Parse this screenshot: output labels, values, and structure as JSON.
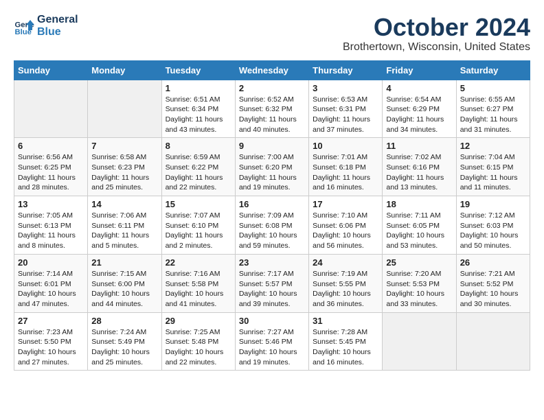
{
  "header": {
    "logo_general": "General",
    "logo_blue": "Blue",
    "month_title": "October 2024",
    "location": "Brothertown, Wisconsin, United States"
  },
  "days_of_week": [
    "Sunday",
    "Monday",
    "Tuesday",
    "Wednesday",
    "Thursday",
    "Friday",
    "Saturday"
  ],
  "weeks": [
    [
      {
        "day": "",
        "empty": true
      },
      {
        "day": "",
        "empty": true
      },
      {
        "day": "1",
        "sunrise": "Sunrise: 6:51 AM",
        "sunset": "Sunset: 6:34 PM",
        "daylight": "Daylight: 11 hours and 43 minutes."
      },
      {
        "day": "2",
        "sunrise": "Sunrise: 6:52 AM",
        "sunset": "Sunset: 6:32 PM",
        "daylight": "Daylight: 11 hours and 40 minutes."
      },
      {
        "day": "3",
        "sunrise": "Sunrise: 6:53 AM",
        "sunset": "Sunset: 6:31 PM",
        "daylight": "Daylight: 11 hours and 37 minutes."
      },
      {
        "day": "4",
        "sunrise": "Sunrise: 6:54 AM",
        "sunset": "Sunset: 6:29 PM",
        "daylight": "Daylight: 11 hours and 34 minutes."
      },
      {
        "day": "5",
        "sunrise": "Sunrise: 6:55 AM",
        "sunset": "Sunset: 6:27 PM",
        "daylight": "Daylight: 11 hours and 31 minutes."
      }
    ],
    [
      {
        "day": "6",
        "sunrise": "Sunrise: 6:56 AM",
        "sunset": "Sunset: 6:25 PM",
        "daylight": "Daylight: 11 hours and 28 minutes."
      },
      {
        "day": "7",
        "sunrise": "Sunrise: 6:58 AM",
        "sunset": "Sunset: 6:23 PM",
        "daylight": "Daylight: 11 hours and 25 minutes."
      },
      {
        "day": "8",
        "sunrise": "Sunrise: 6:59 AM",
        "sunset": "Sunset: 6:22 PM",
        "daylight": "Daylight: 11 hours and 22 minutes."
      },
      {
        "day": "9",
        "sunrise": "Sunrise: 7:00 AM",
        "sunset": "Sunset: 6:20 PM",
        "daylight": "Daylight: 11 hours and 19 minutes."
      },
      {
        "day": "10",
        "sunrise": "Sunrise: 7:01 AM",
        "sunset": "Sunset: 6:18 PM",
        "daylight": "Daylight: 11 hours and 16 minutes."
      },
      {
        "day": "11",
        "sunrise": "Sunrise: 7:02 AM",
        "sunset": "Sunset: 6:16 PM",
        "daylight": "Daylight: 11 hours and 13 minutes."
      },
      {
        "day": "12",
        "sunrise": "Sunrise: 7:04 AM",
        "sunset": "Sunset: 6:15 PM",
        "daylight": "Daylight: 11 hours and 11 minutes."
      }
    ],
    [
      {
        "day": "13",
        "sunrise": "Sunrise: 7:05 AM",
        "sunset": "Sunset: 6:13 PM",
        "daylight": "Daylight: 11 hours and 8 minutes."
      },
      {
        "day": "14",
        "sunrise": "Sunrise: 7:06 AM",
        "sunset": "Sunset: 6:11 PM",
        "daylight": "Daylight: 11 hours and 5 minutes."
      },
      {
        "day": "15",
        "sunrise": "Sunrise: 7:07 AM",
        "sunset": "Sunset: 6:10 PM",
        "daylight": "Daylight: 11 hours and 2 minutes."
      },
      {
        "day": "16",
        "sunrise": "Sunrise: 7:09 AM",
        "sunset": "Sunset: 6:08 PM",
        "daylight": "Daylight: 10 hours and 59 minutes."
      },
      {
        "day": "17",
        "sunrise": "Sunrise: 7:10 AM",
        "sunset": "Sunset: 6:06 PM",
        "daylight": "Daylight: 10 hours and 56 minutes."
      },
      {
        "day": "18",
        "sunrise": "Sunrise: 7:11 AM",
        "sunset": "Sunset: 6:05 PM",
        "daylight": "Daylight: 10 hours and 53 minutes."
      },
      {
        "day": "19",
        "sunrise": "Sunrise: 7:12 AM",
        "sunset": "Sunset: 6:03 PM",
        "daylight": "Daylight: 10 hours and 50 minutes."
      }
    ],
    [
      {
        "day": "20",
        "sunrise": "Sunrise: 7:14 AM",
        "sunset": "Sunset: 6:01 PM",
        "daylight": "Daylight: 10 hours and 47 minutes."
      },
      {
        "day": "21",
        "sunrise": "Sunrise: 7:15 AM",
        "sunset": "Sunset: 6:00 PM",
        "daylight": "Daylight: 10 hours and 44 minutes."
      },
      {
        "day": "22",
        "sunrise": "Sunrise: 7:16 AM",
        "sunset": "Sunset: 5:58 PM",
        "daylight": "Daylight: 10 hours and 41 minutes."
      },
      {
        "day": "23",
        "sunrise": "Sunrise: 7:17 AM",
        "sunset": "Sunset: 5:57 PM",
        "daylight": "Daylight: 10 hours and 39 minutes."
      },
      {
        "day": "24",
        "sunrise": "Sunrise: 7:19 AM",
        "sunset": "Sunset: 5:55 PM",
        "daylight": "Daylight: 10 hours and 36 minutes."
      },
      {
        "day": "25",
        "sunrise": "Sunrise: 7:20 AM",
        "sunset": "Sunset: 5:53 PM",
        "daylight": "Daylight: 10 hours and 33 minutes."
      },
      {
        "day": "26",
        "sunrise": "Sunrise: 7:21 AM",
        "sunset": "Sunset: 5:52 PM",
        "daylight": "Daylight: 10 hours and 30 minutes."
      }
    ],
    [
      {
        "day": "27",
        "sunrise": "Sunrise: 7:23 AM",
        "sunset": "Sunset: 5:50 PM",
        "daylight": "Daylight: 10 hours and 27 minutes."
      },
      {
        "day": "28",
        "sunrise": "Sunrise: 7:24 AM",
        "sunset": "Sunset: 5:49 PM",
        "daylight": "Daylight: 10 hours and 25 minutes."
      },
      {
        "day": "29",
        "sunrise": "Sunrise: 7:25 AM",
        "sunset": "Sunset: 5:48 PM",
        "daylight": "Daylight: 10 hours and 22 minutes."
      },
      {
        "day": "30",
        "sunrise": "Sunrise: 7:27 AM",
        "sunset": "Sunset: 5:46 PM",
        "daylight": "Daylight: 10 hours and 19 minutes."
      },
      {
        "day": "31",
        "sunrise": "Sunrise: 7:28 AM",
        "sunset": "Sunset: 5:45 PM",
        "daylight": "Daylight: 10 hours and 16 minutes."
      },
      {
        "day": "",
        "empty": true
      },
      {
        "day": "",
        "empty": true
      }
    ]
  ]
}
